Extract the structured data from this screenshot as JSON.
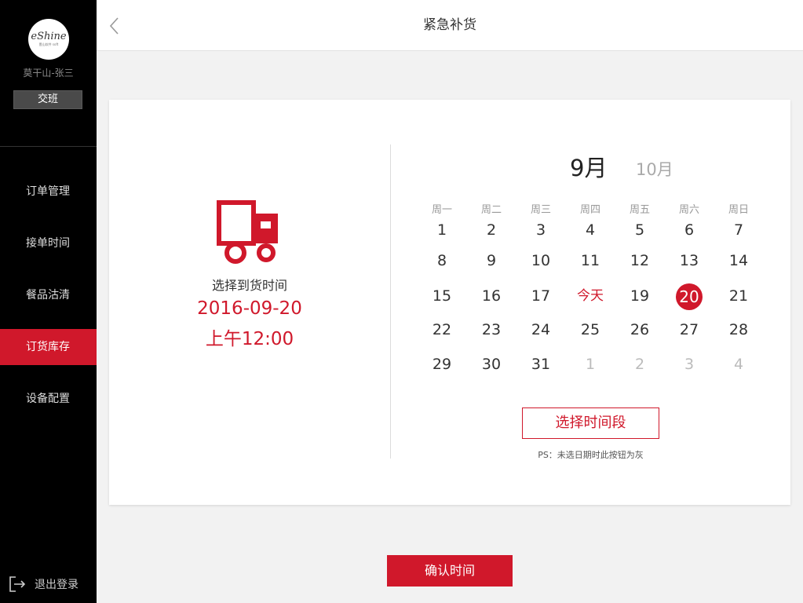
{
  "sidebar": {
    "logo_text": "eShine",
    "logo_subtext": "壹山软件 soft",
    "user_name": "莫干山-张三",
    "shift_button": "交班",
    "nav_items": [
      {
        "label": "订单管理",
        "active": false
      },
      {
        "label": "接单时间",
        "active": false
      },
      {
        "label": "餐品沽清",
        "active": false
      },
      {
        "label": "订货库存",
        "active": true
      },
      {
        "label": "设备配置",
        "active": false
      }
    ],
    "logout_label": "退出登录"
  },
  "header": {
    "title": "紧急补货",
    "back_icon": "chevron-left-icon"
  },
  "arrival": {
    "label": "选择到货时间",
    "date": "2016-09-20",
    "time": "上午12:00",
    "icon": "truck-icon"
  },
  "calendar": {
    "current_month": "9月",
    "next_month": "10月",
    "weekdays": [
      "周一",
      "周二",
      "周三",
      "周四",
      "周五",
      "周六",
      "周日"
    ],
    "weeks": [
      [
        {
          "t": "1"
        },
        {
          "t": "2"
        },
        {
          "t": "3"
        },
        {
          "t": "4"
        },
        {
          "t": "5"
        },
        {
          "t": "6"
        },
        {
          "t": "7"
        }
      ],
      [
        {
          "t": "8"
        },
        {
          "t": "9"
        },
        {
          "t": "10"
        },
        {
          "t": "11"
        },
        {
          "t": "12"
        },
        {
          "t": "13"
        },
        {
          "t": "14"
        }
      ],
      [
        {
          "t": "15"
        },
        {
          "t": "16"
        },
        {
          "t": "17"
        },
        {
          "t": "今天",
          "today": true
        },
        {
          "t": "19"
        },
        {
          "t": "20",
          "selected": true
        },
        {
          "t": "21"
        }
      ],
      [
        {
          "t": "22"
        },
        {
          "t": "23"
        },
        {
          "t": "24"
        },
        {
          "t": "25"
        },
        {
          "t": "26"
        },
        {
          "t": "27"
        },
        {
          "t": "28"
        }
      ],
      [
        {
          "t": "29"
        },
        {
          "t": "30"
        },
        {
          "t": "31"
        },
        {
          "t": "1",
          "muted": true
        },
        {
          "t": "2",
          "muted": true
        },
        {
          "t": "3",
          "muted": true
        },
        {
          "t": "4",
          "muted": true
        }
      ]
    ],
    "choose_period_button": "选择时间段",
    "ps_note": "PS：未选日期时此按钮为灰"
  },
  "confirm_button": "确认时间",
  "colors": {
    "accent": "#d0182b",
    "sidebar_bg": "#000000",
    "page_bg": "#f2f2f2"
  }
}
